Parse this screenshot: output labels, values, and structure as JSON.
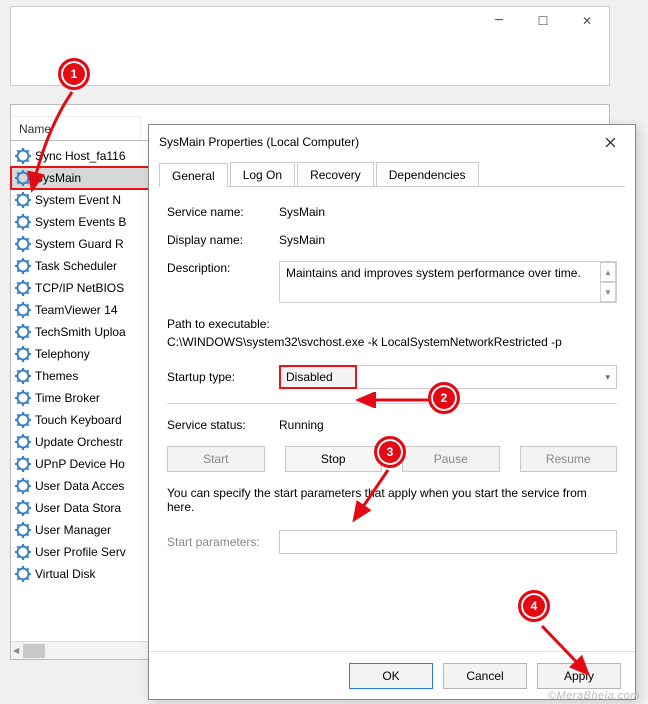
{
  "parent": {
    "minimize": "−",
    "maximize": "☐",
    "close": "✕"
  },
  "list": {
    "column_header": "Name",
    "items": [
      "Sync Host_fa116",
      "SysMain",
      "System Event N",
      "System Events B",
      "System Guard R",
      "Task Scheduler",
      "TCP/IP NetBIOS",
      "TeamViewer 14",
      "TechSmith Uploa",
      "Telephony",
      "Themes",
      "Time Broker",
      "Touch Keyboard",
      "Update Orchestr",
      "UPnP Device Ho",
      "User Data Acces",
      "User Data Stora",
      "User Manager",
      "User Profile Serv",
      "Virtual Disk"
    ],
    "selected_index": 1,
    "scroll_left_glyph": "◀"
  },
  "dialog": {
    "title": "SysMain Properties (Local Computer)",
    "tabs": [
      "General",
      "Log On",
      "Recovery",
      "Dependencies"
    ],
    "active_tab": 0,
    "labels": {
      "service_name": "Service name:",
      "display_name": "Display name:",
      "description": "Description:",
      "path": "Path to executable:",
      "startup_type": "Startup type:",
      "service_status": "Service status:",
      "start_parameters": "Start parameters:",
      "note": "You can specify the start parameters that apply when you start the service from here."
    },
    "values": {
      "service_name": "SysMain",
      "display_name": "SysMain",
      "description": "Maintains and improves system performance over time.",
      "path": "C:\\WINDOWS\\system32\\svchost.exe -k LocalSystemNetworkRestricted -p",
      "startup_type": "Disabled",
      "service_status": "Running",
      "start_parameters": ""
    },
    "service_buttons": {
      "start": "Start",
      "stop": "Stop",
      "pause": "Pause",
      "resume": "Resume"
    },
    "bottom_buttons": {
      "ok": "OK",
      "cancel": "Cancel",
      "apply": "Apply"
    }
  },
  "badges": {
    "1": "1",
    "2": "2",
    "3": "3",
    "4": "4"
  },
  "watermark": "©MeraBheja.com"
}
